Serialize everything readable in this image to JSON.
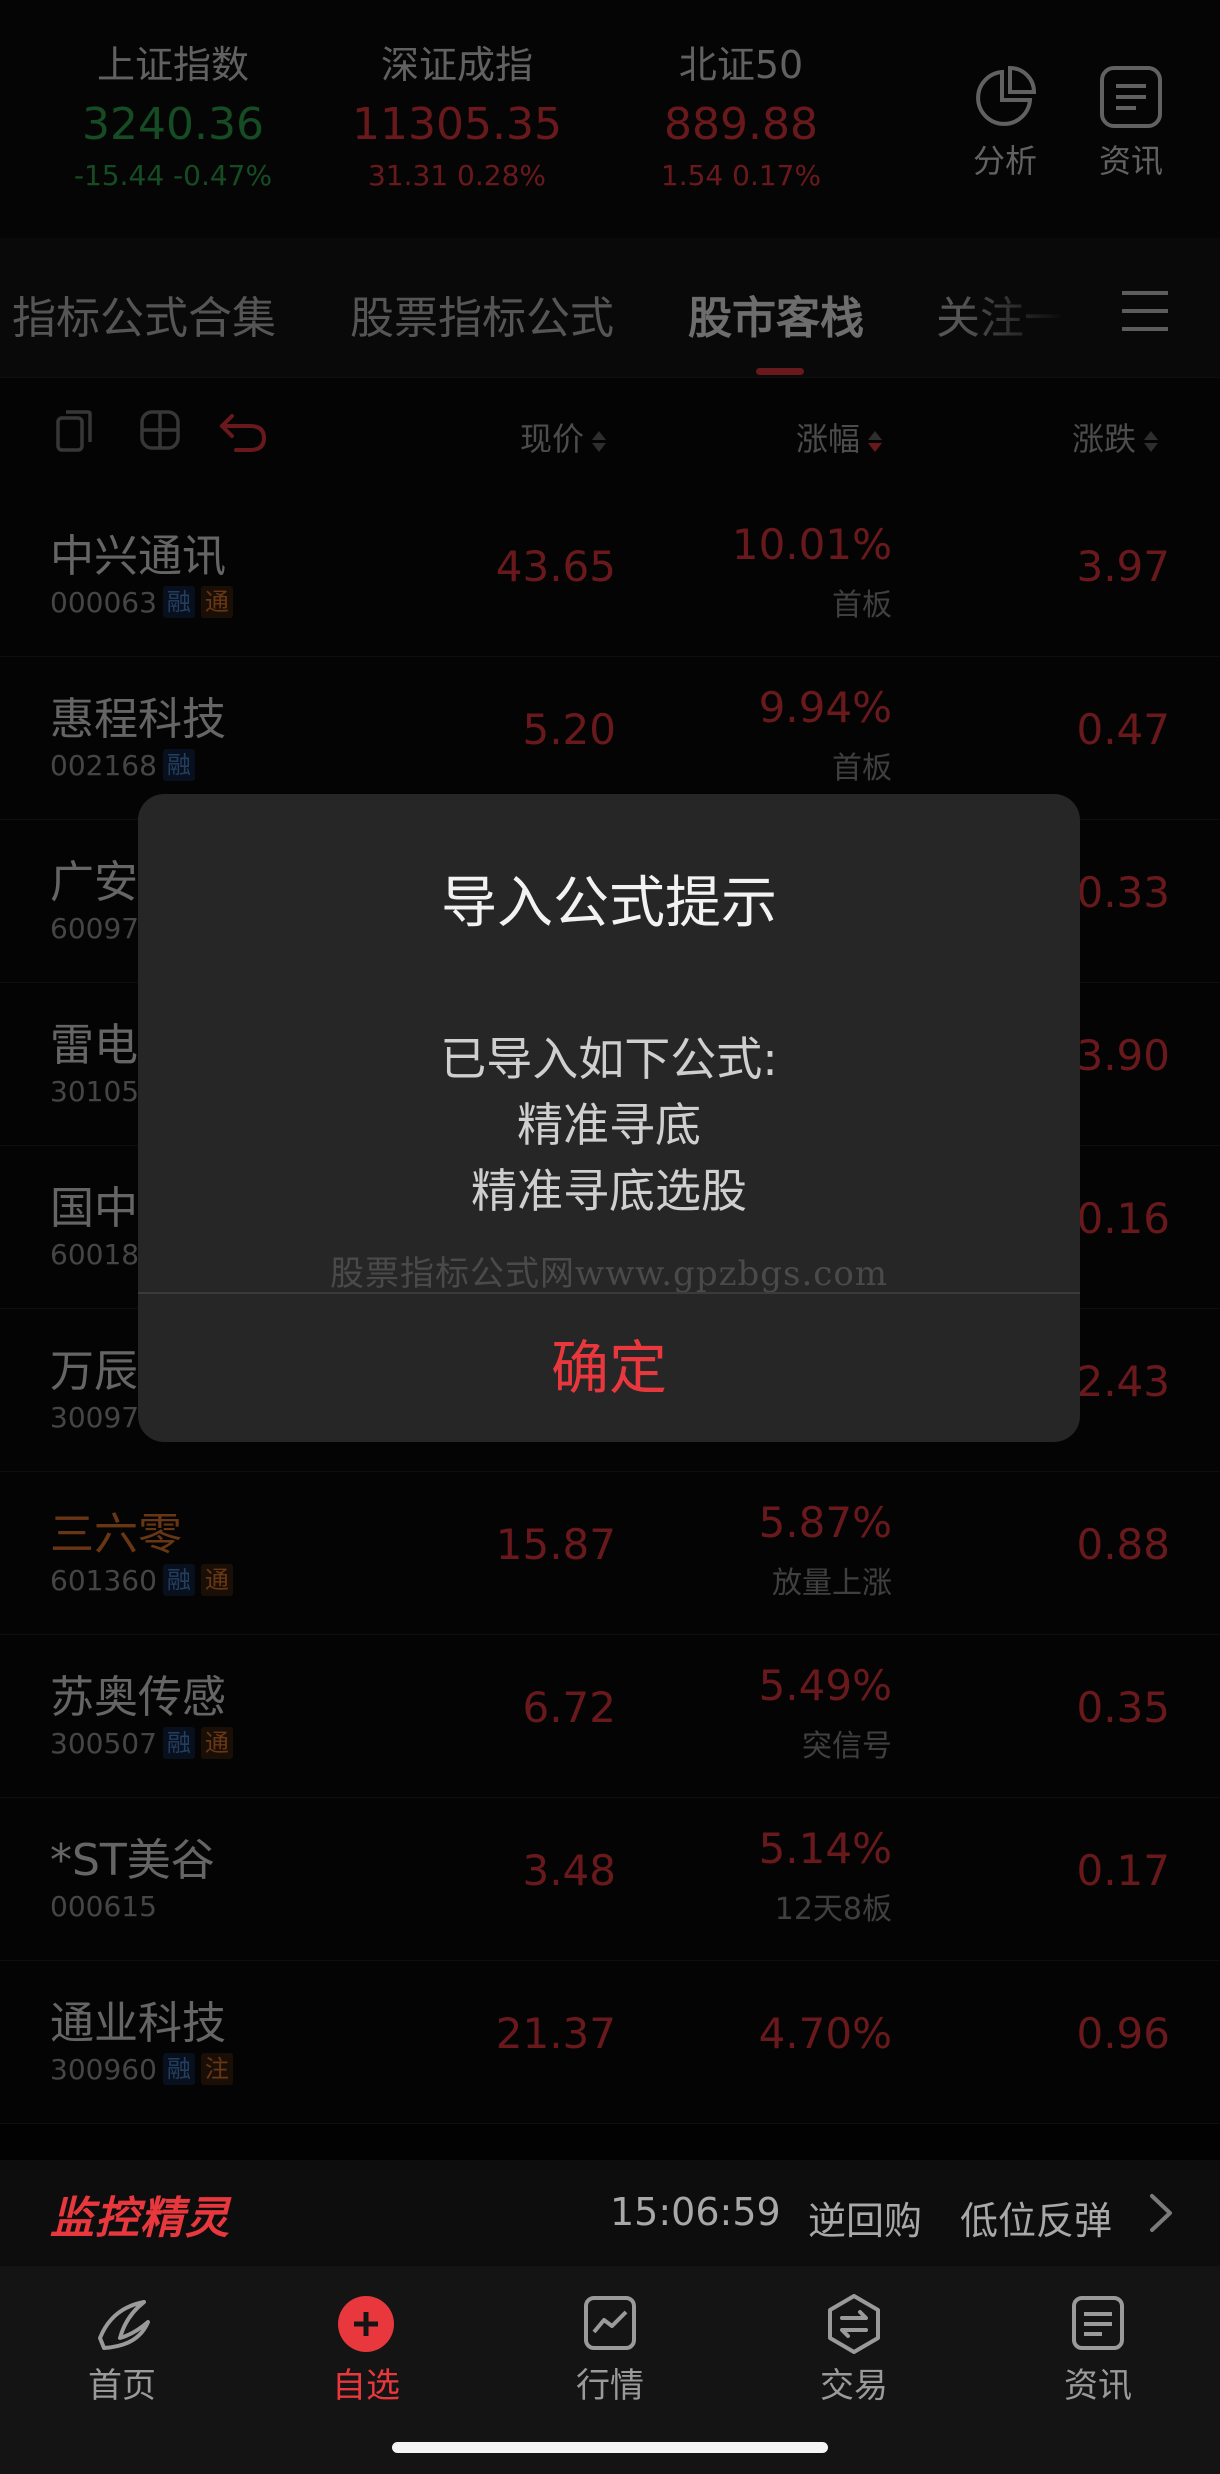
{
  "indices": [
    {
      "name": "上证指数",
      "value": "3240.36",
      "change": "-15.44  -0.47%",
      "trend": "down"
    },
    {
      "name": "深证成指",
      "value": "11305.35",
      "change": "31.31  0.28%",
      "trend": "up"
    },
    {
      "name": "北证50",
      "value": "889.88",
      "change": "1.54  0.17%",
      "trend": "up"
    }
  ],
  "top_buttons": {
    "analysis": "分析",
    "news": "资讯"
  },
  "tabs": [
    "指标公式合集",
    "股票指标公式",
    "股市客栈",
    "关注一"
  ],
  "columns": {
    "price": "现价",
    "pct": "涨幅",
    "change": "涨跌"
  },
  "stocks": [
    {
      "name": "中兴通讯",
      "code": "000063",
      "tags": [
        "融",
        "通"
      ],
      "price": "43.65",
      "pct": "10.01%",
      "note": "首板",
      "change": "3.97"
    },
    {
      "name": "惠程科技",
      "code": "002168",
      "tags": [
        "融"
      ],
      "price": "5.20",
      "pct": "9.94%",
      "note": "首板",
      "change": "0.47"
    },
    {
      "name": "广安",
      "code": "60097",
      "change": "0.33"
    },
    {
      "name": "雷电",
      "code": "30105",
      "change": "3.90"
    },
    {
      "name": "国中",
      "code": "60018",
      "change": "0.16"
    },
    {
      "name": "万辰",
      "code": "30097",
      "change": "2.43"
    },
    {
      "name": "三六零",
      "code": "601360",
      "tags": [
        "融",
        "通"
      ],
      "price": "15.87",
      "pct": "5.87%",
      "note": "放量上涨",
      "change": "0.88"
    },
    {
      "name": "苏奥传感",
      "code": "300507",
      "tags": [
        "融",
        "通"
      ],
      "price": "6.72",
      "pct": "5.49%",
      "note": "突信号",
      "change": "0.35"
    },
    {
      "name": "*ST美谷",
      "code": "000615",
      "tags": [],
      "price": "3.48",
      "pct": "5.14%",
      "note": "12天8板",
      "change": "0.17"
    },
    {
      "name": "通业科技",
      "code": "300960",
      "tags": [
        "融",
        "注"
      ],
      "price": "21.37",
      "pct": "4.70%",
      "note": "",
      "change": "0.96"
    }
  ],
  "modal": {
    "title": "导入公式提示",
    "line1": "已导入如下公式:",
    "line2": "精准寻底",
    "line3": "精准寻底选股",
    "watermark": "股票指标公式网www.gpzbgs.com",
    "confirm": "确定"
  },
  "monitor": {
    "brand": "监控精灵",
    "time": "15:06:59",
    "tip1": "逆回购",
    "tip2": "低位反弹"
  },
  "nav": [
    "首页",
    "自选",
    "行情",
    "交易",
    "资讯"
  ],
  "colors": {
    "up": "#e8383d",
    "down": "#2fa84f",
    "accent": "#e8383d",
    "highlight_name": "#e9792b"
  }
}
